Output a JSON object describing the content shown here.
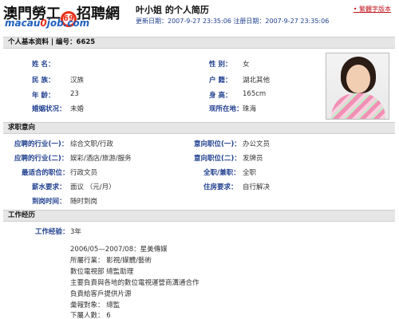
{
  "header": {
    "logo_title_left": "澳門勞工",
    "logo_circle": "69",
    "logo_title_right": "招聘網",
    "logo_sub": "macau",
    "logo_sub_com": "0",
    "logo_sub_tail": "job.com",
    "page_name": "叶小姐  的个人简历",
    "update_line": "更新日期：2007-9-27  23:35:06  注册日期：2007-9-27  23:35:06",
    "lang_link": "繁體字版本",
    "lang_dot": "•"
  },
  "basic": {
    "section_title": "个人基本资料  | 编号：6625",
    "name_label": "姓    名：",
    "name_value": "",
    "gender_label": "性    别：",
    "gender_value": "女",
    "ethnic_label": "民    族：",
    "ethnic_value": "汉族",
    "hukou_label": "户    籍：",
    "hukou_value": "湖北其他",
    "age_label": "年    龄：",
    "age_value": "23",
    "height_label": "身    高：",
    "height_value": "165cm",
    "marital_label": "婚姻状况：",
    "marital_value": "未婚",
    "location_label": "现所在地：",
    "location_value": "珠海"
  },
  "intent": {
    "section_title": "求职意向",
    "ind1_label": "应聘的行业(一)：",
    "ind1_value": "综合文职/行政",
    "pos1_label": "意向职位(一)：",
    "pos1_value": "办公文员",
    "ind2_label": "应聘的行业(二)：",
    "ind2_value": "娱彩/酒店/旅游/服务",
    "pos2_label": "意向职位(二)：",
    "pos2_value": "发牌员",
    "best_label": "最适合的职位：",
    "best_value": "行政文员",
    "type_label": "全职/兼职：",
    "type_value": "全职",
    "salary_label": "薪水要求：",
    "salary_value": "面议 （元/月）",
    "housing_label": "住房要求：",
    "housing_value": "自行解决",
    "arrive_label": "到岗时间：",
    "arrive_value": "随时到岗"
  },
  "experience": {
    "section_title": "工作经历",
    "years_label": "工作经验：",
    "years_value": "3年",
    "lines": [
      "2006/05—2007/08：星美傳媒",
      "所屬行業：  影視/媒體/藝術",
      "數位電視部    總監助理",
      "主要負責與各地的數位電視運營商溝通合作",
      "負責給客戶提供片源",
      "彙報對象：  總監",
      "下屬人數：  6"
    ]
  }
}
